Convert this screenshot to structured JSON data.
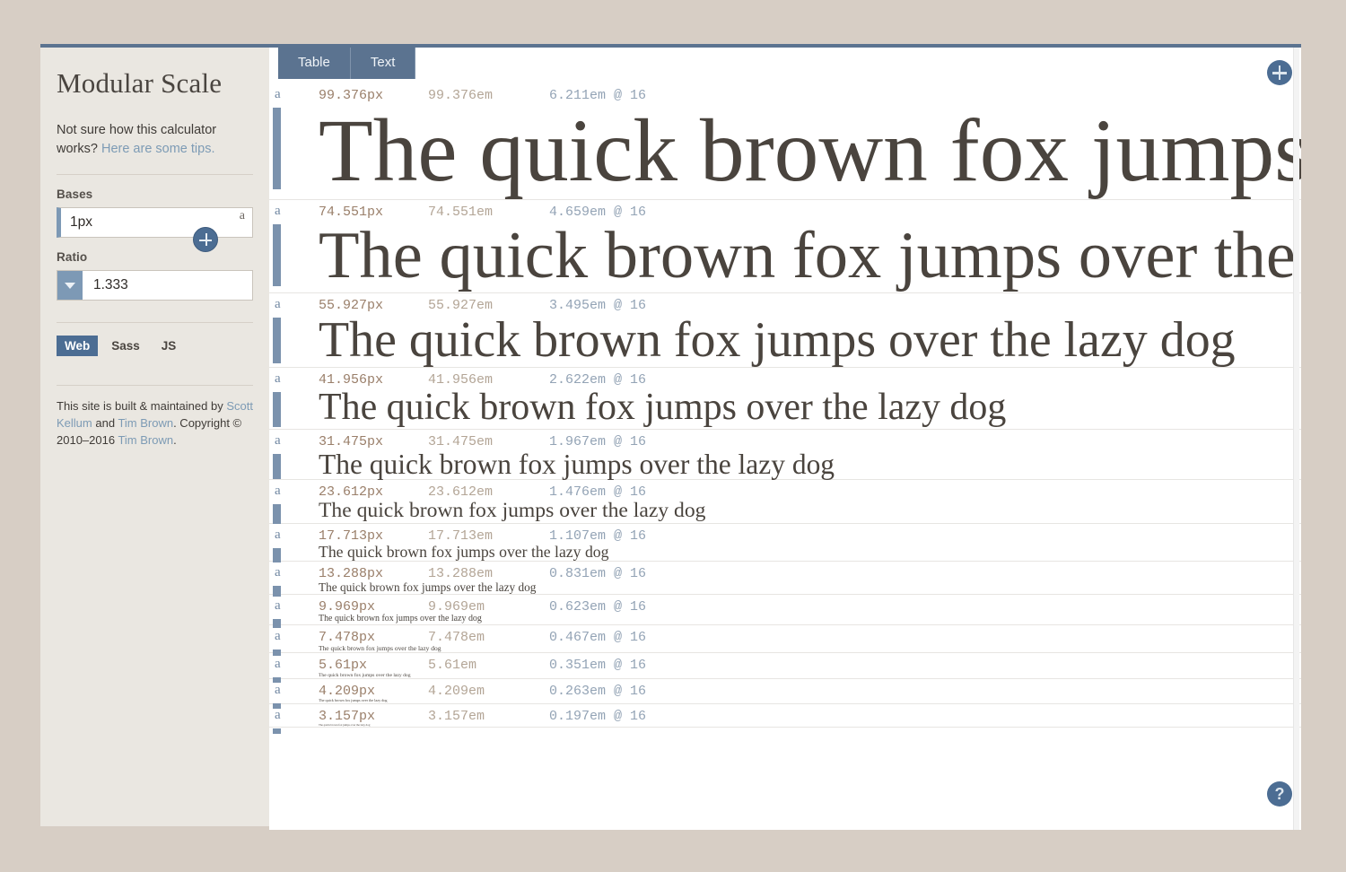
{
  "sidebar": {
    "title": "Modular Scale",
    "tips_prefix": "Not sure how this calculator works? ",
    "tips_link": "Here are some tips.",
    "bases_label": "Bases",
    "bases_value": "1px",
    "bases_unit_marker": "a",
    "add_base_icon": "plus-circle-icon",
    "ratio_label": "Ratio",
    "ratio_value": "1.333",
    "ratio_caret_icon": "chevron-down-icon",
    "lang_tabs": [
      {
        "label": "Web",
        "active": true
      },
      {
        "label": "Sass",
        "active": false
      },
      {
        "label": "JS",
        "active": false
      }
    ],
    "credits": {
      "part1": "This site is built & maintained by ",
      "link1": "Scott Kellum",
      "part2": " and ",
      "link2": "Tim Brown",
      "part3": ". Copyright © 2010–2016 ",
      "link3": "Tim Brown",
      "part4": "."
    }
  },
  "main": {
    "view_tabs": [
      {
        "label": "Table"
      },
      {
        "label": "Text"
      }
    ],
    "add_icon": "plus-circle-icon",
    "help_icon": "question-mark-icon",
    "help_label": "?",
    "sample_text": "The quick brown fox jumps over the lazy dog",
    "rows": [
      {
        "marker": "a",
        "px": "99.376px",
        "em": "99.376em",
        "rem": "6.211em @ 16",
        "size": 99.376
      },
      {
        "marker": "a",
        "px": "74.551px",
        "em": "74.551em",
        "rem": "4.659em @ 16",
        "size": 74.551
      },
      {
        "marker": "a",
        "px": "55.927px",
        "em": "55.927em",
        "rem": "3.495em @ 16",
        "size": 55.927
      },
      {
        "marker": "a",
        "px": "41.956px",
        "em": "41.956em",
        "rem": "2.622em @ 16",
        "size": 41.956
      },
      {
        "marker": "a",
        "px": "31.475px",
        "em": "31.475em",
        "rem": "1.967em @ 16",
        "size": 31.475
      },
      {
        "marker": "a",
        "px": "23.612px",
        "em": "23.612em",
        "rem": "1.476em @ 16",
        "size": 23.612
      },
      {
        "marker": "a",
        "px": "17.713px",
        "em": "17.713em",
        "rem": "1.107em @ 16",
        "size": 17.713
      },
      {
        "marker": "a",
        "px": "13.288px",
        "em": "13.288em",
        "rem": "0.831em @ 16",
        "size": 13.288
      },
      {
        "marker": "a",
        "px": "9.969px",
        "em": "9.969em",
        "rem": "0.623em @ 16",
        "size": 9.969
      },
      {
        "marker": "a",
        "px": "7.478px",
        "em": "7.478em",
        "rem": "0.467em @ 16",
        "size": 7.478
      },
      {
        "marker": "a",
        "px": "5.61px",
        "em": "5.61em",
        "rem": "0.351em @ 16",
        "size": 5.61
      },
      {
        "marker": "a",
        "px": "4.209px",
        "em": "4.209em",
        "rem": "0.263em @ 16",
        "size": 4.209
      },
      {
        "marker": "a",
        "px": "3.157px",
        "em": "3.157em",
        "rem": "0.197em @ 16",
        "size": 3.157
      }
    ]
  },
  "colors": {
    "page_background": "#d7cec5",
    "sidebar_background": "#eae7e1",
    "accent_blue": "#4c6d93",
    "tab_blue": "#5b7390",
    "link_blue": "#7d9bb5",
    "px_text": "#9a7f6a",
    "em_text": "#b3a596",
    "rem_text": "#93a3b5",
    "sample_text": "#4a443e"
  }
}
